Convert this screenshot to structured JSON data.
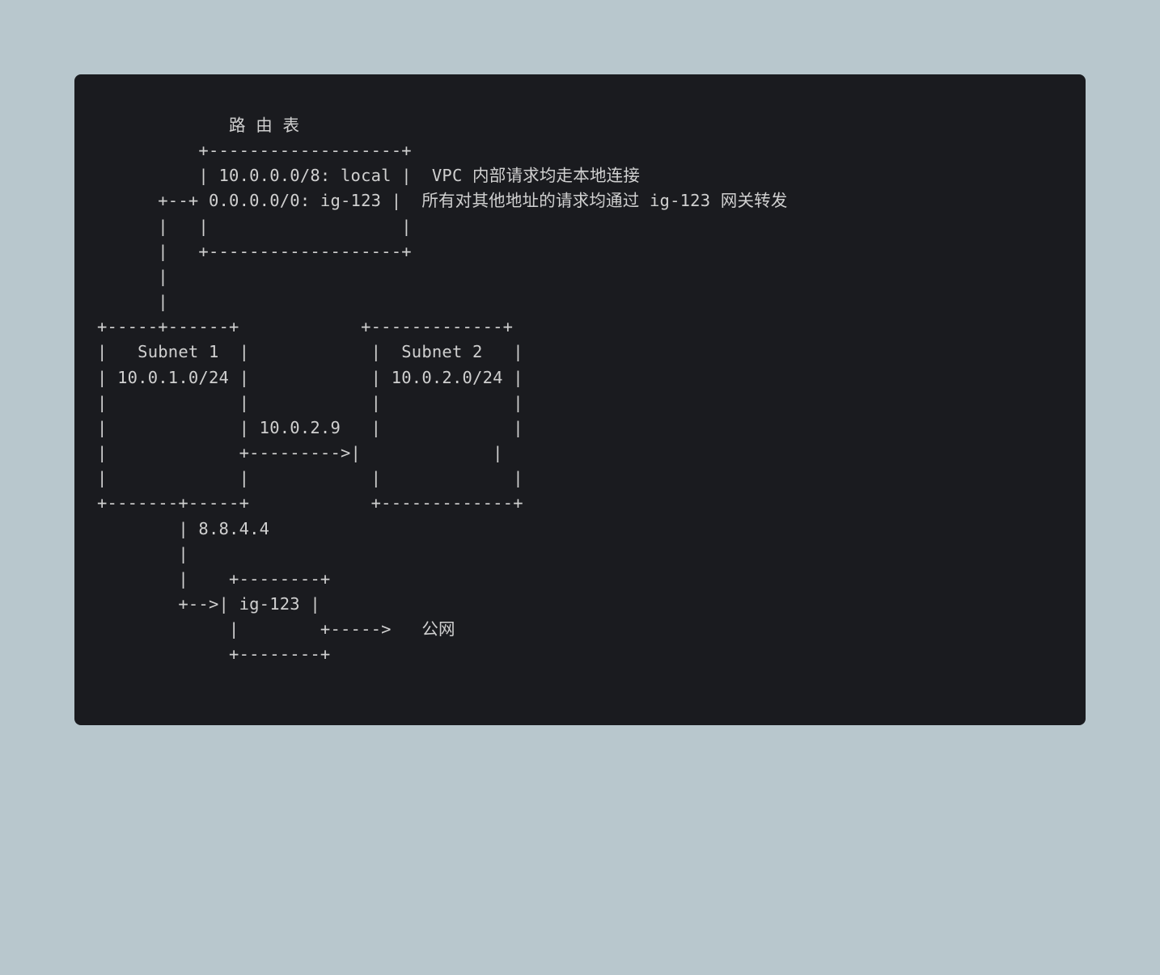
{
  "diagram": {
    "title": "路 由 表",
    "route_table": {
      "rules": [
        {
          "cidr": "10.0.0.0/8",
          "target": "local",
          "note": "VPC 内部请求均走本地连接"
        },
        {
          "cidr": "0.0.0.0/0",
          "target": "ig-123",
          "note": "所有对其他地址的请求均通过 ig-123 网关转发"
        }
      ]
    },
    "subnets": [
      {
        "name": "Subnet 1",
        "cidr": "10.0.1.0/24"
      },
      {
        "name": "Subnet 2",
        "cidr": "10.0.2.0/24"
      }
    ],
    "flows": [
      {
        "dest_ip": "10.0.2.9",
        "via": "local"
      },
      {
        "dest_ip": "8.8.4.4",
        "via": "ig-123"
      }
    ],
    "gateway": {
      "id": "ig-123",
      "to": "公网"
    }
  },
  "ascii": "             路 由 表\n          +-------------------+\n          | 10.0.0.0/8: local |  VPC 内部请求均走本地连接\n      +--+ 0.0.0.0/0: ig-123 |  所有对其他地址的请求均通过 ig-123 网关转发\n      |   |                   |\n      |   +-------------------+\n      |\n      |\n+-----+------+            +-------------+\n|   Subnet 1  |            |  Subnet 2   |\n| 10.0.1.0/24 |            | 10.0.2.0/24 |\n|             |            |             |\n|             | 10.0.2.9   |             |\n|             +--------->|             |\n|             |            |             |\n+-------+-----+            +-------------+\n        | 8.8.4.4\n        |\n        |    +--------+\n        +-->| ig-123 |\n             |        +----->   公网\n             +--------+"
}
